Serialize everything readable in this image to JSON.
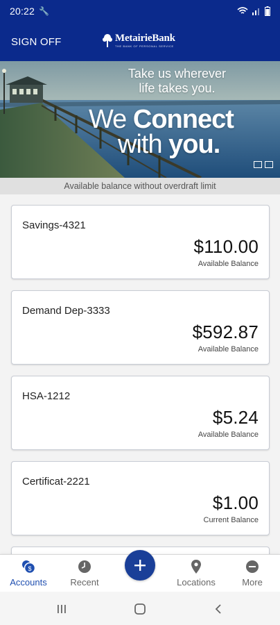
{
  "status_bar": {
    "time": "20:22"
  },
  "header": {
    "sign_off": "SIGN OFF",
    "logo_name": "MetairieBank",
    "logo_tagline": "THE BANK OF PERSONAL SERVICE"
  },
  "banner": {
    "tagline_line1": "Take us wherever",
    "tagline_line2": "life takes you.",
    "headline_we": "We ",
    "headline_connect": "Connect",
    "headline_with": "with ",
    "headline_you": "you."
  },
  "notice": "Available balance without overdraft limit",
  "accounts": [
    {
      "name": "Savings-4321",
      "amount": "$110.00",
      "balance_type": "Available Balance"
    },
    {
      "name": "Demand Dep-3333",
      "amount": "$592.87",
      "balance_type": "Available Balance"
    },
    {
      "name": "HSA-1212",
      "amount": "$5.24",
      "balance_type": "Available Balance"
    },
    {
      "name": "Certificat-2221",
      "amount": "$1.00",
      "balance_type": "Current Balance"
    }
  ],
  "bottom_nav": {
    "accounts": "Accounts",
    "recent": "Recent",
    "locations": "Locations",
    "more": "More",
    "active": "accounts"
  },
  "colors": {
    "brand_blue": "#0b2a8c",
    "accent_blue": "#1a3f98",
    "active_label": "#1f4fb0"
  },
  "icons": {
    "status": [
      "wrench-icon",
      "wifi-icon",
      "signal-icon",
      "battery-icon"
    ],
    "nav": [
      "accounts-icon",
      "clock-icon",
      "plus-icon",
      "location-pin-icon",
      "more-icon"
    ],
    "system": [
      "recents-icon",
      "home-icon",
      "back-icon"
    ]
  }
}
